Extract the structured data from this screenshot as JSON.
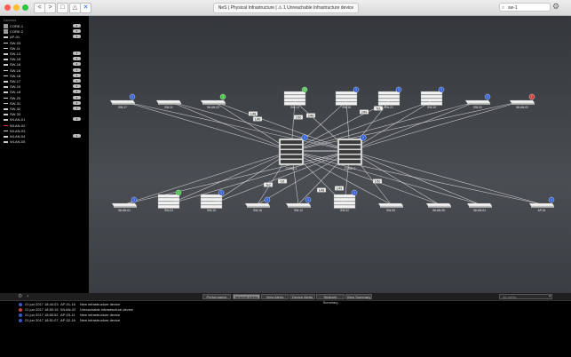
{
  "window": {
    "address": "NeS | Physical Infrastructure | ⚠ 1 Unreachable Infrastructure device",
    "search_value": "sw-1",
    "buttons": {
      "back": "<",
      "forward": ">",
      "sidebar": "□",
      "share": "△",
      "tools": "✕"
    }
  },
  "sidebar": {
    "title": "Devices",
    "items": [
      {
        "label": "CORE-1",
        "count": "2",
        "icon": "dev"
      },
      {
        "label": "CORE-2",
        "count": "2",
        "icon": "dev"
      },
      {
        "label": "AP-01",
        "count": "2",
        "icon": "line"
      },
      {
        "label": "SW-03",
        "count": "",
        "icon": "line"
      },
      {
        "label": "SW-11",
        "count": "",
        "icon": "line"
      },
      {
        "label": "SW-13",
        "count": "1",
        "icon": "line"
      },
      {
        "label": "SW-15",
        "count": "2",
        "icon": "line"
      },
      {
        "label": "SW-16",
        "count": "2",
        "icon": "line"
      },
      {
        "label": "SW-16",
        "count": "1",
        "icon": "line"
      },
      {
        "label": "SW-18",
        "count": "1",
        "icon": "line"
      },
      {
        "label": "SW-17",
        "count": "1",
        "icon": "line"
      },
      {
        "label": "SW-19",
        "count": "1",
        "icon": "line"
      },
      {
        "label": "SW-18",
        "count": "1",
        "icon": "line"
      },
      {
        "label": "SW-20",
        "count": "2",
        "icon": "line"
      },
      {
        "label": "SW-31",
        "count": "2",
        "icon": "line"
      },
      {
        "label": "SW-32",
        "count": "1",
        "icon": "line"
      },
      {
        "label": "SW-33",
        "count": "",
        "icon": "line"
      },
      {
        "label": "WLAN-01",
        "count": "2",
        "icon": "line"
      },
      {
        "label": "WLAN-02",
        "count": "",
        "icon": "red"
      },
      {
        "label": "WLAN-03",
        "count": "",
        "icon": "line"
      },
      {
        "label": "WLAN-04",
        "count": "1",
        "icon": "line"
      },
      {
        "label": "WLAN-05",
        "count": "",
        "icon": "line"
      }
    ]
  },
  "topology": {
    "top_row": [
      {
        "label": "SW-17",
        "badge": "1",
        "color": "#2b5bd7",
        "type": "switch"
      },
      {
        "label": "SW-11",
        "badge": "",
        "color": "",
        "type": "switch"
      },
      {
        "label": "WLAN-03",
        "badge": "1",
        "color": "#3cc23c",
        "type": "switch"
      },
      {
        "label": "SW-13",
        "badge": "12",
        "color": "#3cc23c",
        "type": "stack"
      },
      {
        "label": "SW-18",
        "badge": "1",
        "color": "#2b5bd7",
        "type": "stack"
      },
      {
        "label": "SW-21",
        "badge": "1",
        "color": "#2b5bd7",
        "type": "stack"
      },
      {
        "label": "SW-19",
        "badge": "1",
        "color": "#2b5bd7",
        "type": "stack"
      },
      {
        "label": "SW-31",
        "badge": "1",
        "color": "#2b5bd7",
        "type": "switch"
      },
      {
        "label": "WLAN-02",
        "badge": "!",
        "color": "#d63a3a",
        "type": "switch"
      }
    ],
    "bottom_row": [
      {
        "label": "WLAN-01",
        "badge": "1",
        "color": "#2b5bd7",
        "type": "switch"
      },
      {
        "label": "SW-03",
        "badge": "1",
        "color": "#3cc23c",
        "type": "stack"
      },
      {
        "label": "SW-15",
        "badge": "1",
        "color": "#2b5bd7",
        "type": "stack"
      },
      {
        "label": "SW-16",
        "badge": "1",
        "color": "#2b5bd7",
        "type": "switch"
      },
      {
        "label": "SW-12",
        "badge": "1",
        "color": "#2b5bd7",
        "type": "switch"
      },
      {
        "label": "SW-32",
        "badge": "1",
        "color": "#2b5bd7",
        "type": "stack"
      },
      {
        "label": "SW-33",
        "badge": "",
        "color": "",
        "type": "switch"
      },
      {
        "label": "WLAN-05",
        "badge": "",
        "color": "",
        "type": "switch"
      },
      {
        "label": "WLAN-04",
        "badge": "",
        "color": "",
        "type": "switch"
      },
      {
        "label": "AP-01",
        "badge": "1",
        "color": "#2b5bd7",
        "type": "switch"
      }
    ],
    "cores": [
      {
        "label": "CORE-1",
        "badge": "2",
        "color": "#2b5bd7"
      },
      {
        "label": "CORE-2",
        "badge": "2",
        "color": "#2b5bd7"
      }
    ],
    "port_labels": [
      "1/48",
      "1/49",
      "1/50",
      "2/48",
      "2/49",
      "Te1",
      "Te2",
      "Gi1"
    ]
  },
  "bottom": {
    "tabs": [
      "Performance",
      "Network Alerts",
      "View Alerts",
      "Device Alerts",
      "Network Summary",
      "View Summary"
    ],
    "active_tab": 1,
    "filter_placeholder": "All alerts",
    "alerts": [
      {
        "time": "21 jun 2017 18:44:23",
        "device": "AP-01-16",
        "msg": "New infrastructure device",
        "color": "#2b5bd7"
      },
      {
        "time": "21 jun 2017 18:50:15",
        "device": "WLAN-02",
        "msg": "Unreachable infrastructure device",
        "color": "#d63a3a"
      },
      {
        "time": "21 jun 2017 18:50:52",
        "device": "AP-03-11",
        "msg": "New infrastructure device",
        "color": "#2b5bd7"
      },
      {
        "time": "21 jun 2017 18:51:07",
        "device": "AP-02-16",
        "msg": "New infrastructure device",
        "color": "#2b5bd7"
      }
    ]
  }
}
